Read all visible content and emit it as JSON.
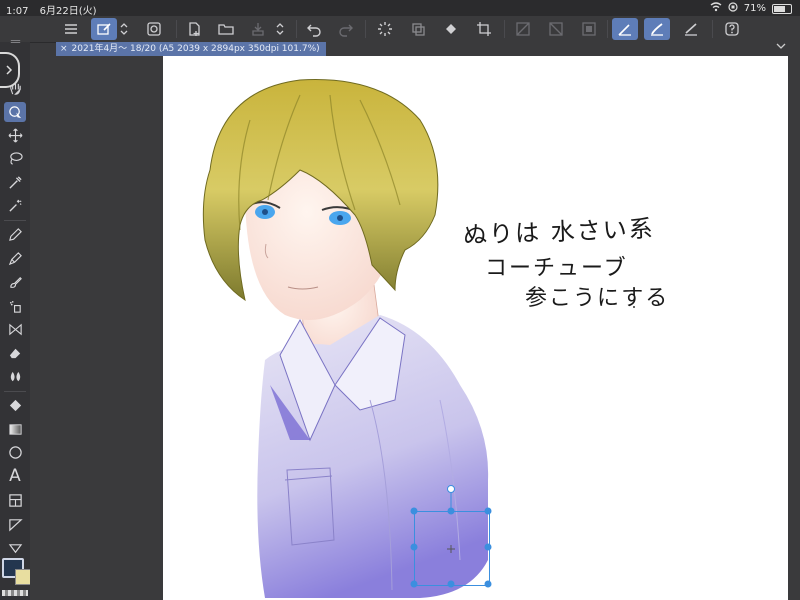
{
  "status_bar": {
    "time": "1:07",
    "date": "6月22日(火)",
    "battery": "71%"
  },
  "document_tab": {
    "close_label": "×",
    "title": "2021年4月～ 18/20 (A5 2039 x 2894px 350dpi 101.7%)"
  },
  "canvas_text": {
    "line1": "ぬりは 水さい系",
    "line2": "コーチューブ",
    "line3": "参こうにする"
  },
  "left_tools": {
    "text_tool_glyph": "A"
  },
  "colors": {
    "main_color": "#24364f",
    "sub_color": "#e8dea0",
    "accent": "#5b74a8",
    "selection": "#3b8fdf"
  }
}
